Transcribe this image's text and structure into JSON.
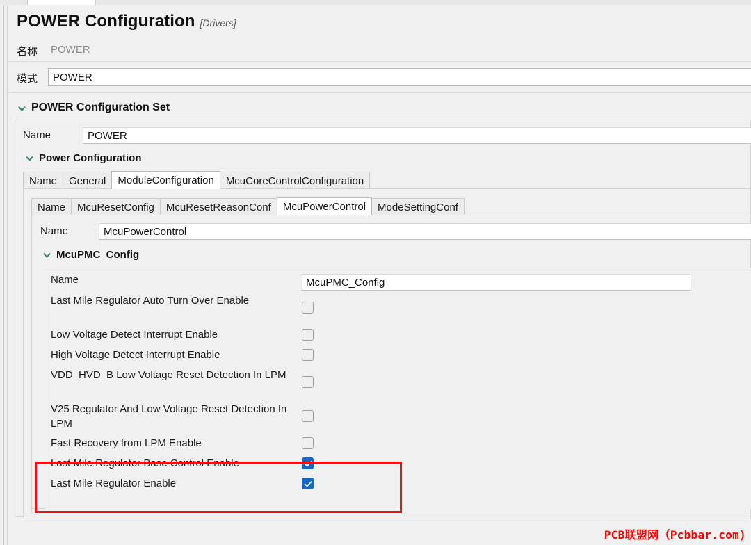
{
  "window": {
    "title": "POWER Configuration",
    "subtitle": "[Drivers]"
  },
  "top_fields": [
    {
      "label": "名称",
      "value": "POWER",
      "readonly": true
    },
    {
      "label": "模式",
      "value": "POWER",
      "readonly": false
    }
  ],
  "section_power_config_set": {
    "title": "POWER Configuration Set",
    "chevron": "chevron-down-icon",
    "name_label": "Name",
    "name_value": "POWER"
  },
  "section_power_configuration": {
    "title": "Power Configuration",
    "chevron": "chevron-down-icon",
    "tabs": [
      {
        "label": "Name",
        "active": false
      },
      {
        "label": "General",
        "active": false
      },
      {
        "label": "ModuleConfiguration",
        "active": true
      },
      {
        "label": "McuCoreControlConfiguration",
        "active": false
      }
    ]
  },
  "module_configuration": {
    "tabs": [
      {
        "label": "Name",
        "active": false
      },
      {
        "label": "McuResetConfig",
        "active": false
      },
      {
        "label": "McuResetReasonConf",
        "active": false
      },
      {
        "label": "McuPowerControl",
        "active": true
      },
      {
        "label": "ModeSettingConf",
        "active": false
      }
    ],
    "name_label": "Name",
    "name_value": "McuPowerControl"
  },
  "section_mcupmc_config": {
    "title": "McuPMC_Config",
    "chevron": "chevron-down-icon"
  },
  "properties": [
    {
      "label": "Name",
      "type": "text",
      "value": "McuPMC_Config"
    },
    {
      "label": "Last Mile Regulator Auto Turn Over Enable",
      "type": "checkbox",
      "checked": false
    },
    {
      "label": "Low Voltage Detect Interrupt Enable",
      "type": "checkbox",
      "checked": false
    },
    {
      "label": "High Voltage Detect Interrupt Enable",
      "type": "checkbox",
      "checked": false
    },
    {
      "label": "VDD_HVD_B Low Voltage Reset Detection In LPM",
      "type": "checkbox",
      "checked": false
    },
    {
      "label": "V25 Regulator And Low Voltage Reset Detection In LPM",
      "type": "checkbox",
      "checked": false
    },
    {
      "label": "Fast Recovery from LPM Enable",
      "type": "checkbox",
      "checked": false
    },
    {
      "label": "Last Mile Regulator Base Control Enable",
      "type": "checkbox",
      "checked": true
    },
    {
      "label": "Last Mile Regulator Enable",
      "type": "checkbox",
      "checked": true
    }
  ],
  "annotation": {
    "highlight_color": "#ee1111",
    "highlighted_rows": [
      "Last Mile Regulator Base Control Enable",
      "Last Mile Regulator Enable"
    ]
  },
  "watermark": {
    "text": "PCB联盟网（Pcbbar.com)",
    "color": "#ff0000"
  },
  "colors": {
    "background": "#f0f0f0",
    "chevron": "#2e8b7a",
    "checkbox_on": "#1568c0",
    "accent_red": "#ee1111"
  }
}
